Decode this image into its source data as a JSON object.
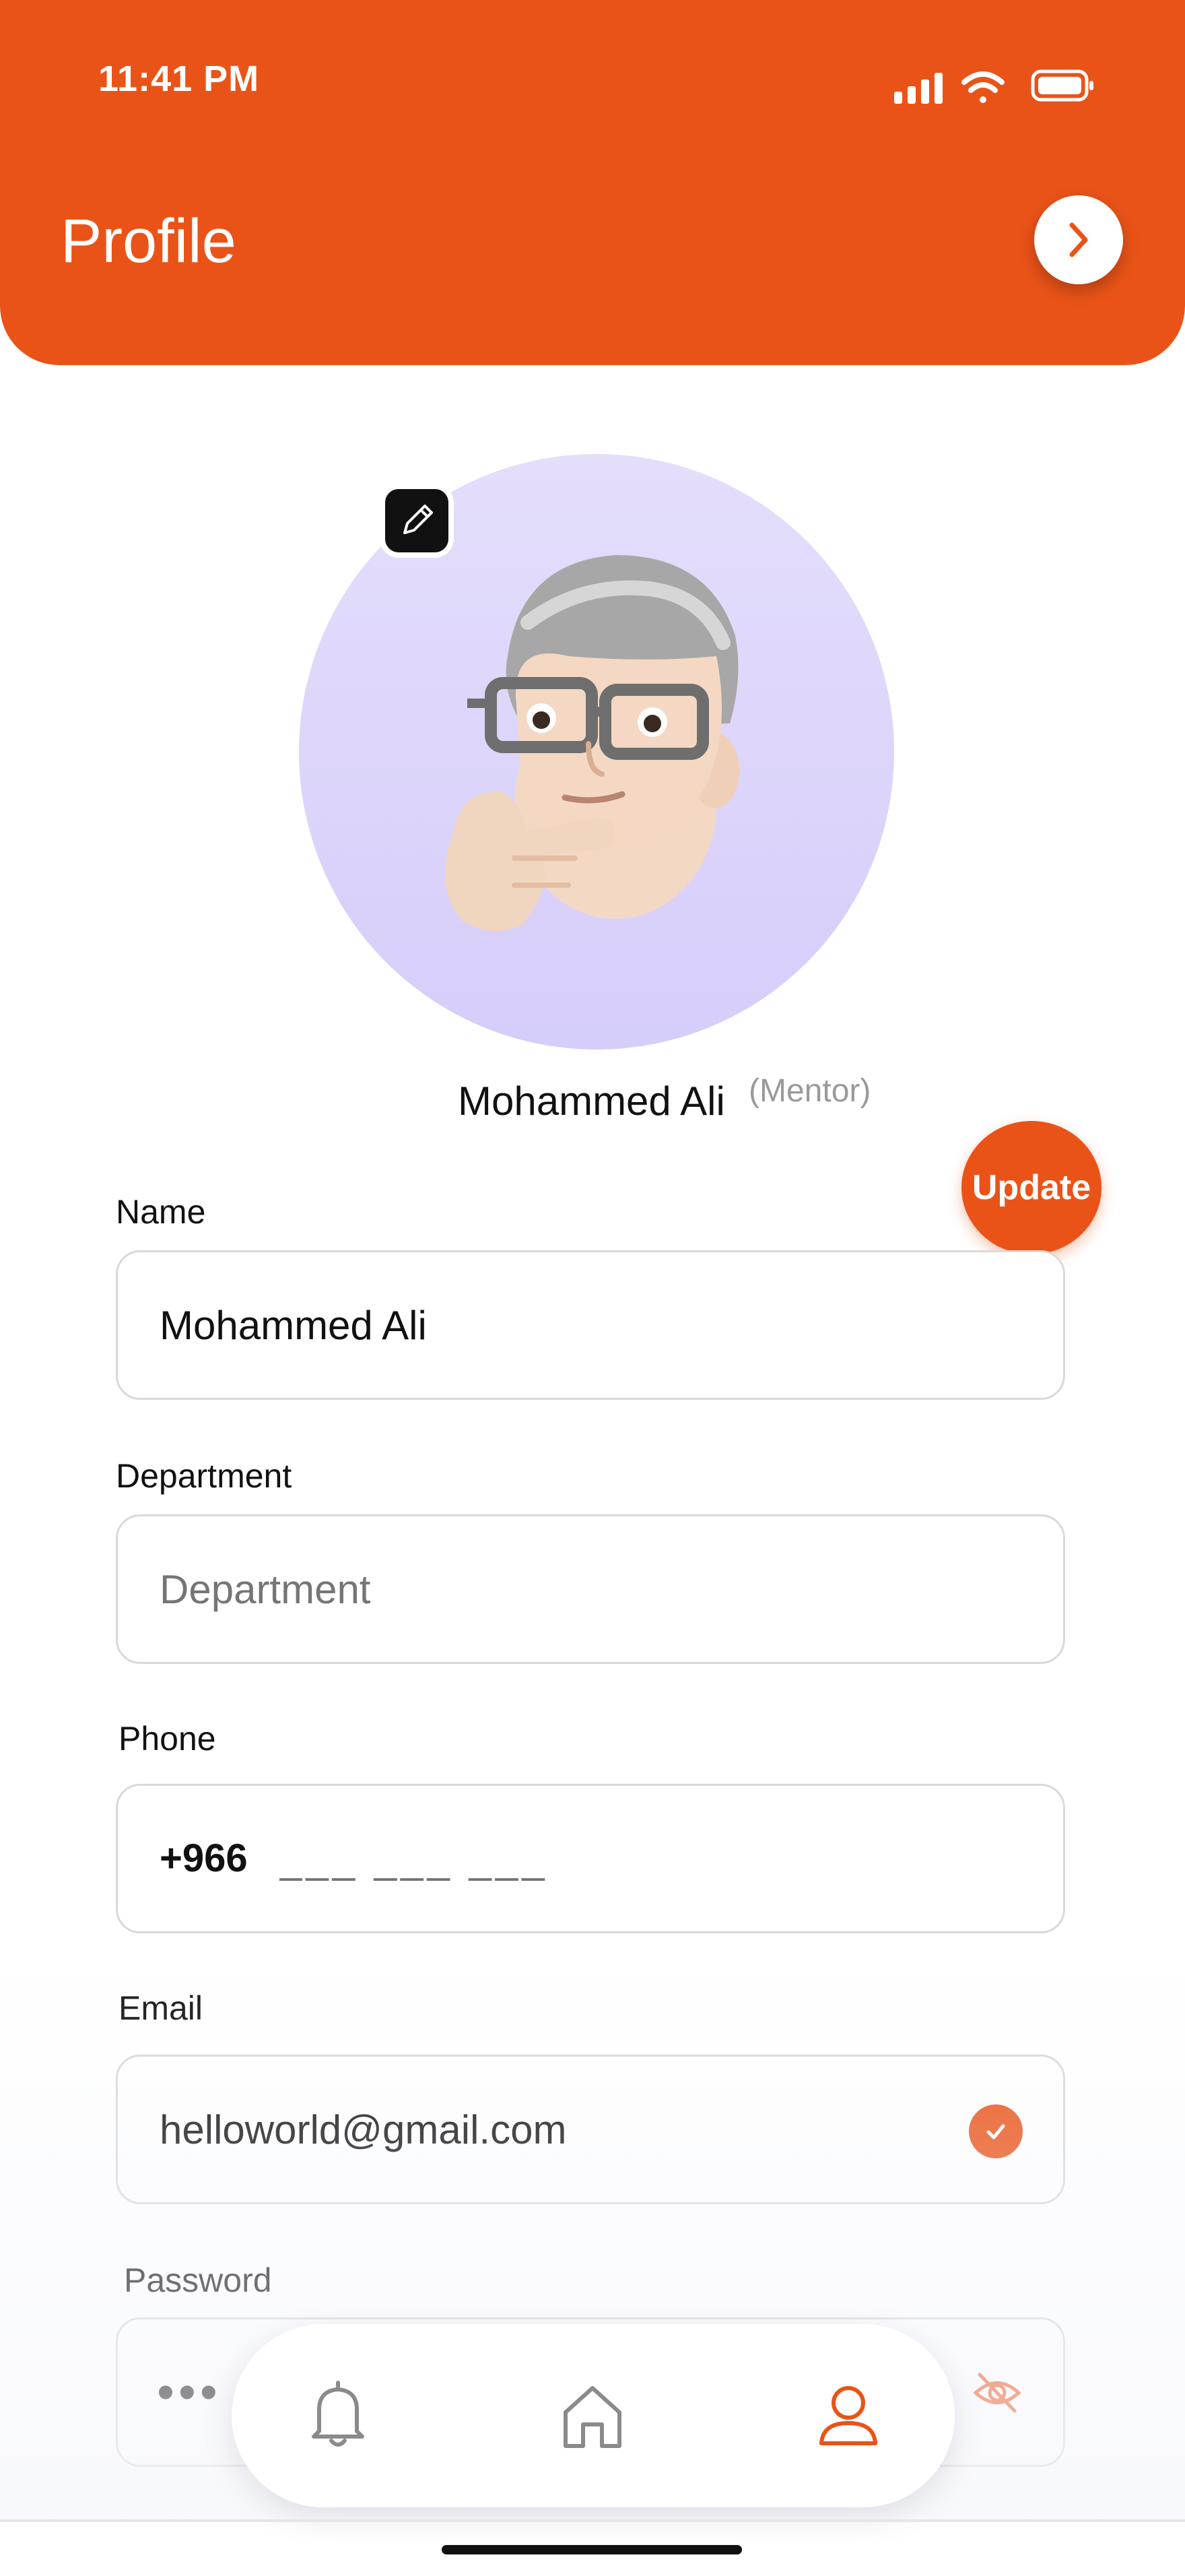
{
  "status_bar": {
    "time": "11:41 PM"
  },
  "header": {
    "title": "Profile"
  },
  "profile": {
    "name": "Mohammed Ali",
    "role": "(Mentor)"
  },
  "actions": {
    "update_label": "Update"
  },
  "form": {
    "name": {
      "label": "Name",
      "value": "Mohammed Ali"
    },
    "department": {
      "label": "Department",
      "placeholder": "Department"
    },
    "phone": {
      "label": "Phone",
      "code": "+966",
      "placeholder": "___ ___ ___"
    },
    "email": {
      "label": "Email",
      "value": "helloworld@gmail.com",
      "verified": true
    },
    "password": {
      "label": "Password",
      "masked": "•••"
    }
  },
  "bottom_nav": {
    "items": [
      {
        "icon": "bell-icon",
        "active": false
      },
      {
        "icon": "home-icon",
        "active": false
      },
      {
        "icon": "user-icon",
        "active": true
      }
    ]
  },
  "colors": {
    "accent": "#EA5318",
    "avatar_bg": "#DDD6FB",
    "inactive_icon": "#8a8a8a"
  }
}
